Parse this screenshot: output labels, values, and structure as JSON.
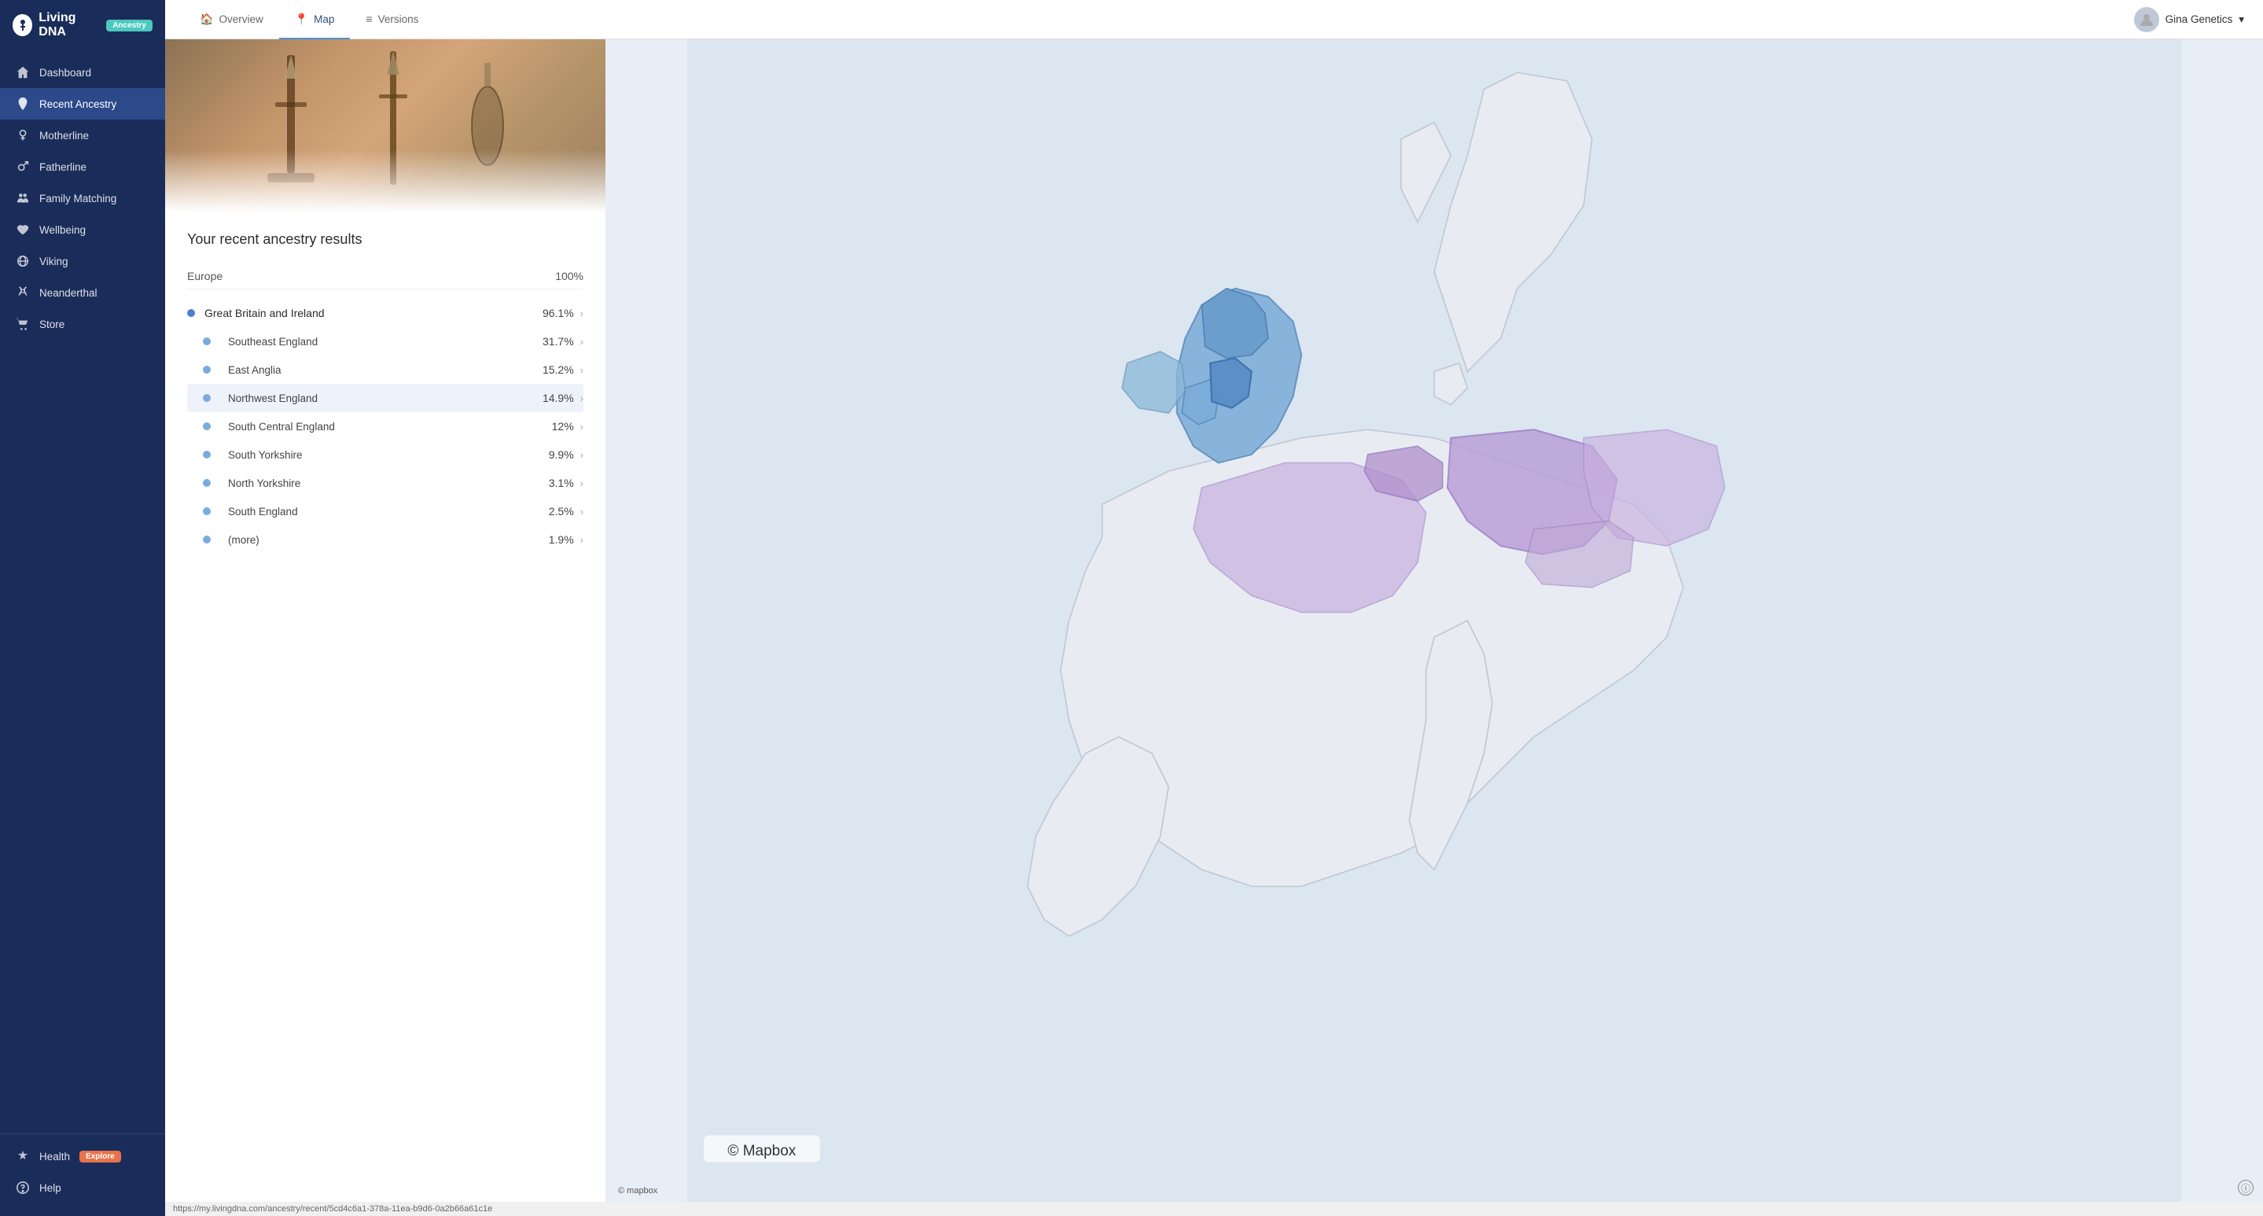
{
  "sidebar": {
    "logo": {
      "icon_text": "L",
      "brand": "Living DNA",
      "badge": "Ancestry"
    },
    "nav_items": [
      {
        "id": "dashboard",
        "label": "Dashboard",
        "icon": "🏠",
        "active": false
      },
      {
        "id": "recent-ancestry",
        "label": "Recent Ancestry",
        "icon": "📍",
        "active": true
      },
      {
        "id": "motherline",
        "label": "Motherline",
        "icon": "♀",
        "active": false
      },
      {
        "id": "fatherline",
        "label": "Fatherline",
        "icon": "♂",
        "active": false
      },
      {
        "id": "family-matching",
        "label": "Family Matching",
        "icon": "👥",
        "active": false
      },
      {
        "id": "wellbeing",
        "label": "Wellbeing",
        "icon": "❤",
        "active": false
      },
      {
        "id": "viking",
        "label": "Viking",
        "icon": "🌐",
        "active": false
      },
      {
        "id": "neanderthal",
        "label": "Neanderthal",
        "icon": "✦",
        "active": false
      },
      {
        "id": "store",
        "label": "Store",
        "icon": "🛒",
        "active": false
      }
    ],
    "bottom_items": [
      {
        "id": "health",
        "label": "Health",
        "icon": "⏳",
        "badge": "Explore"
      },
      {
        "id": "help",
        "label": "Help",
        "icon": "❓"
      }
    ]
  },
  "topnav": {
    "tabs": [
      {
        "id": "overview",
        "label": "Overview",
        "icon": "🏠",
        "active": false
      },
      {
        "id": "map",
        "label": "Map",
        "icon": "📍",
        "active": true
      },
      {
        "id": "versions",
        "label": "Versions",
        "icon": "≡",
        "active": false
      }
    ],
    "user": {
      "name": "Gina Genetics",
      "chevron": "▾"
    }
  },
  "results": {
    "title": "Your recent ancestry results",
    "region_label": "Europe",
    "region_percentage": "100%",
    "main_group": {
      "label": "Great Britain and Ireland",
      "percentage": "96.1%"
    },
    "sub_items": [
      {
        "label": "Southeast England",
        "percentage": "31.7%",
        "highlighted": false
      },
      {
        "label": "East Anglia",
        "percentage": "15.2%",
        "highlighted": false
      },
      {
        "label": "Northwest England",
        "percentage": "14.9%",
        "highlighted": true
      },
      {
        "label": "South Central England",
        "percentage": "12%",
        "highlighted": false
      },
      {
        "label": "South Yorkshire",
        "percentage": "9.9%",
        "highlighted": false
      },
      {
        "label": "North Yorkshire",
        "percentage": "3.1%",
        "highlighted": false
      },
      {
        "label": "South England",
        "percentage": "2.5%",
        "highlighted": false
      },
      {
        "label": "(more)",
        "percentage": "1.9%",
        "highlighted": false
      }
    ]
  },
  "statusbar": {
    "url": "https://my.livingdna.com/ancestry/recent/5cd4c6a1-378a-11ea-b9d6-0a2b66a61c1e"
  }
}
